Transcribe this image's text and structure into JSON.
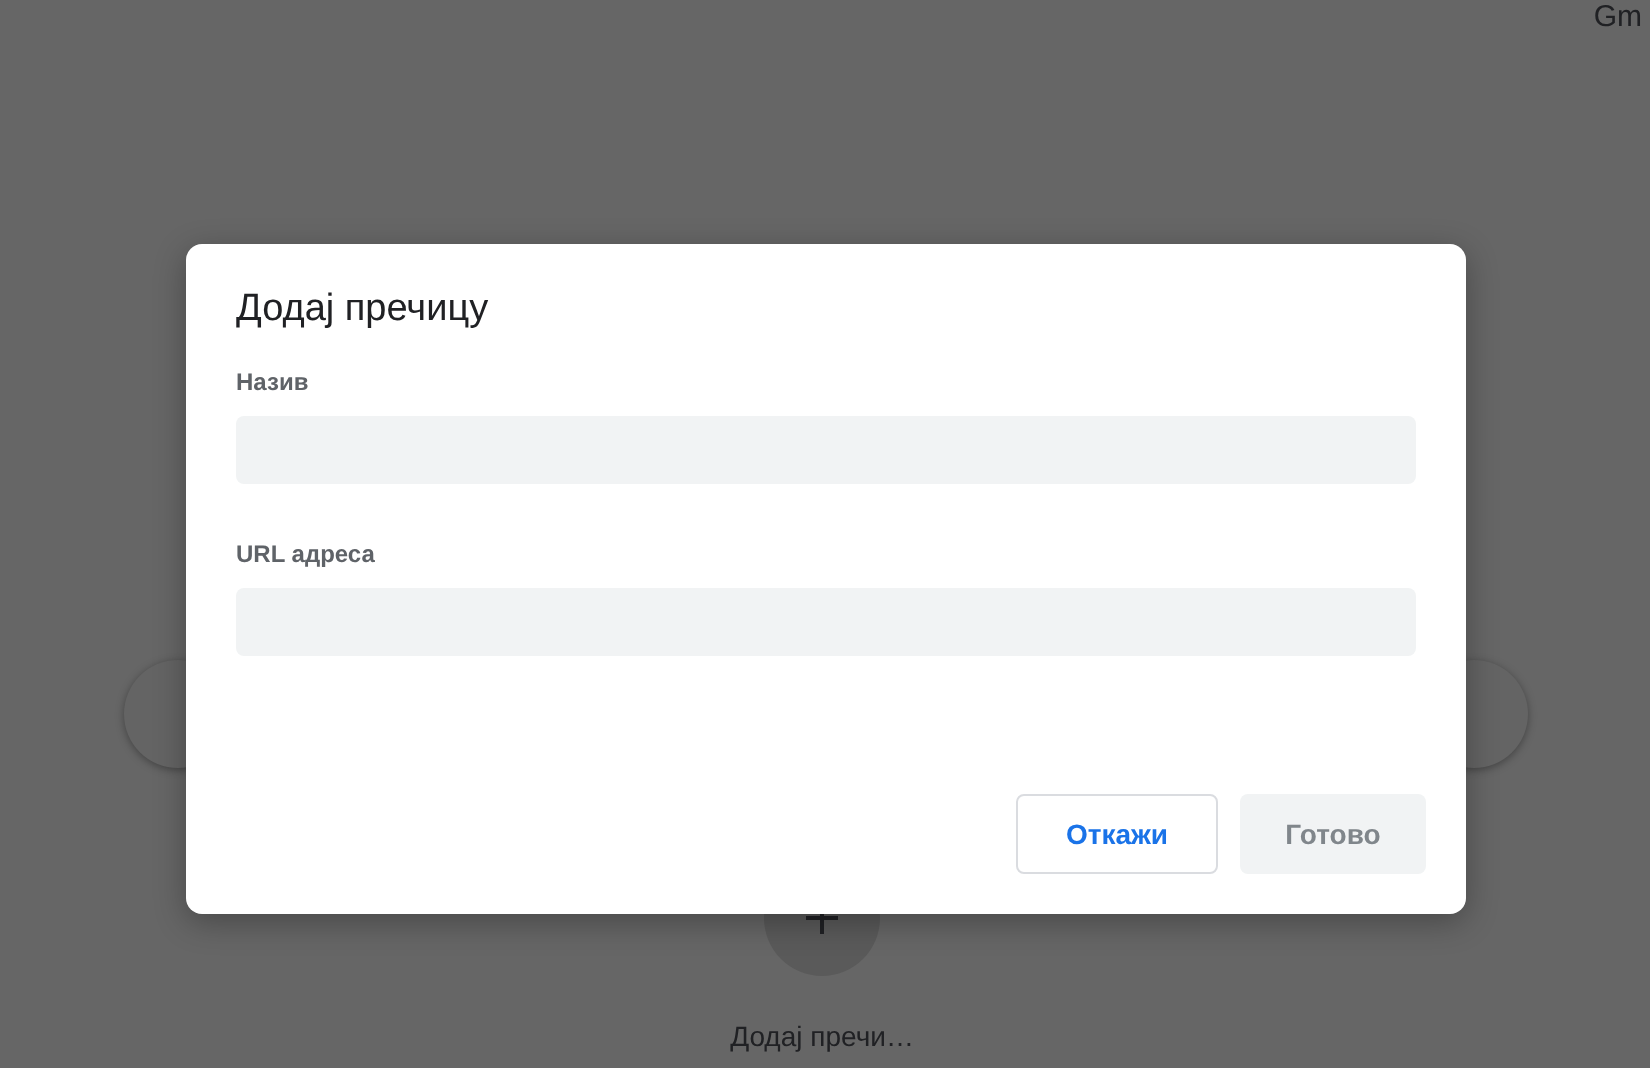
{
  "background": {
    "corner_text": "Gm",
    "shortcut_tile": {
      "label": "Додај пречи…"
    }
  },
  "dialog": {
    "title": "Додај пречицу",
    "fields": [
      {
        "label": "Назив"
      },
      {
        "label": "URL адреса"
      }
    ],
    "buttons": [
      {
        "label": "Откажи",
        "kind": "secondary",
        "disabled": false
      },
      {
        "label": "Готово",
        "kind": "primary",
        "disabled": true
      }
    ]
  }
}
